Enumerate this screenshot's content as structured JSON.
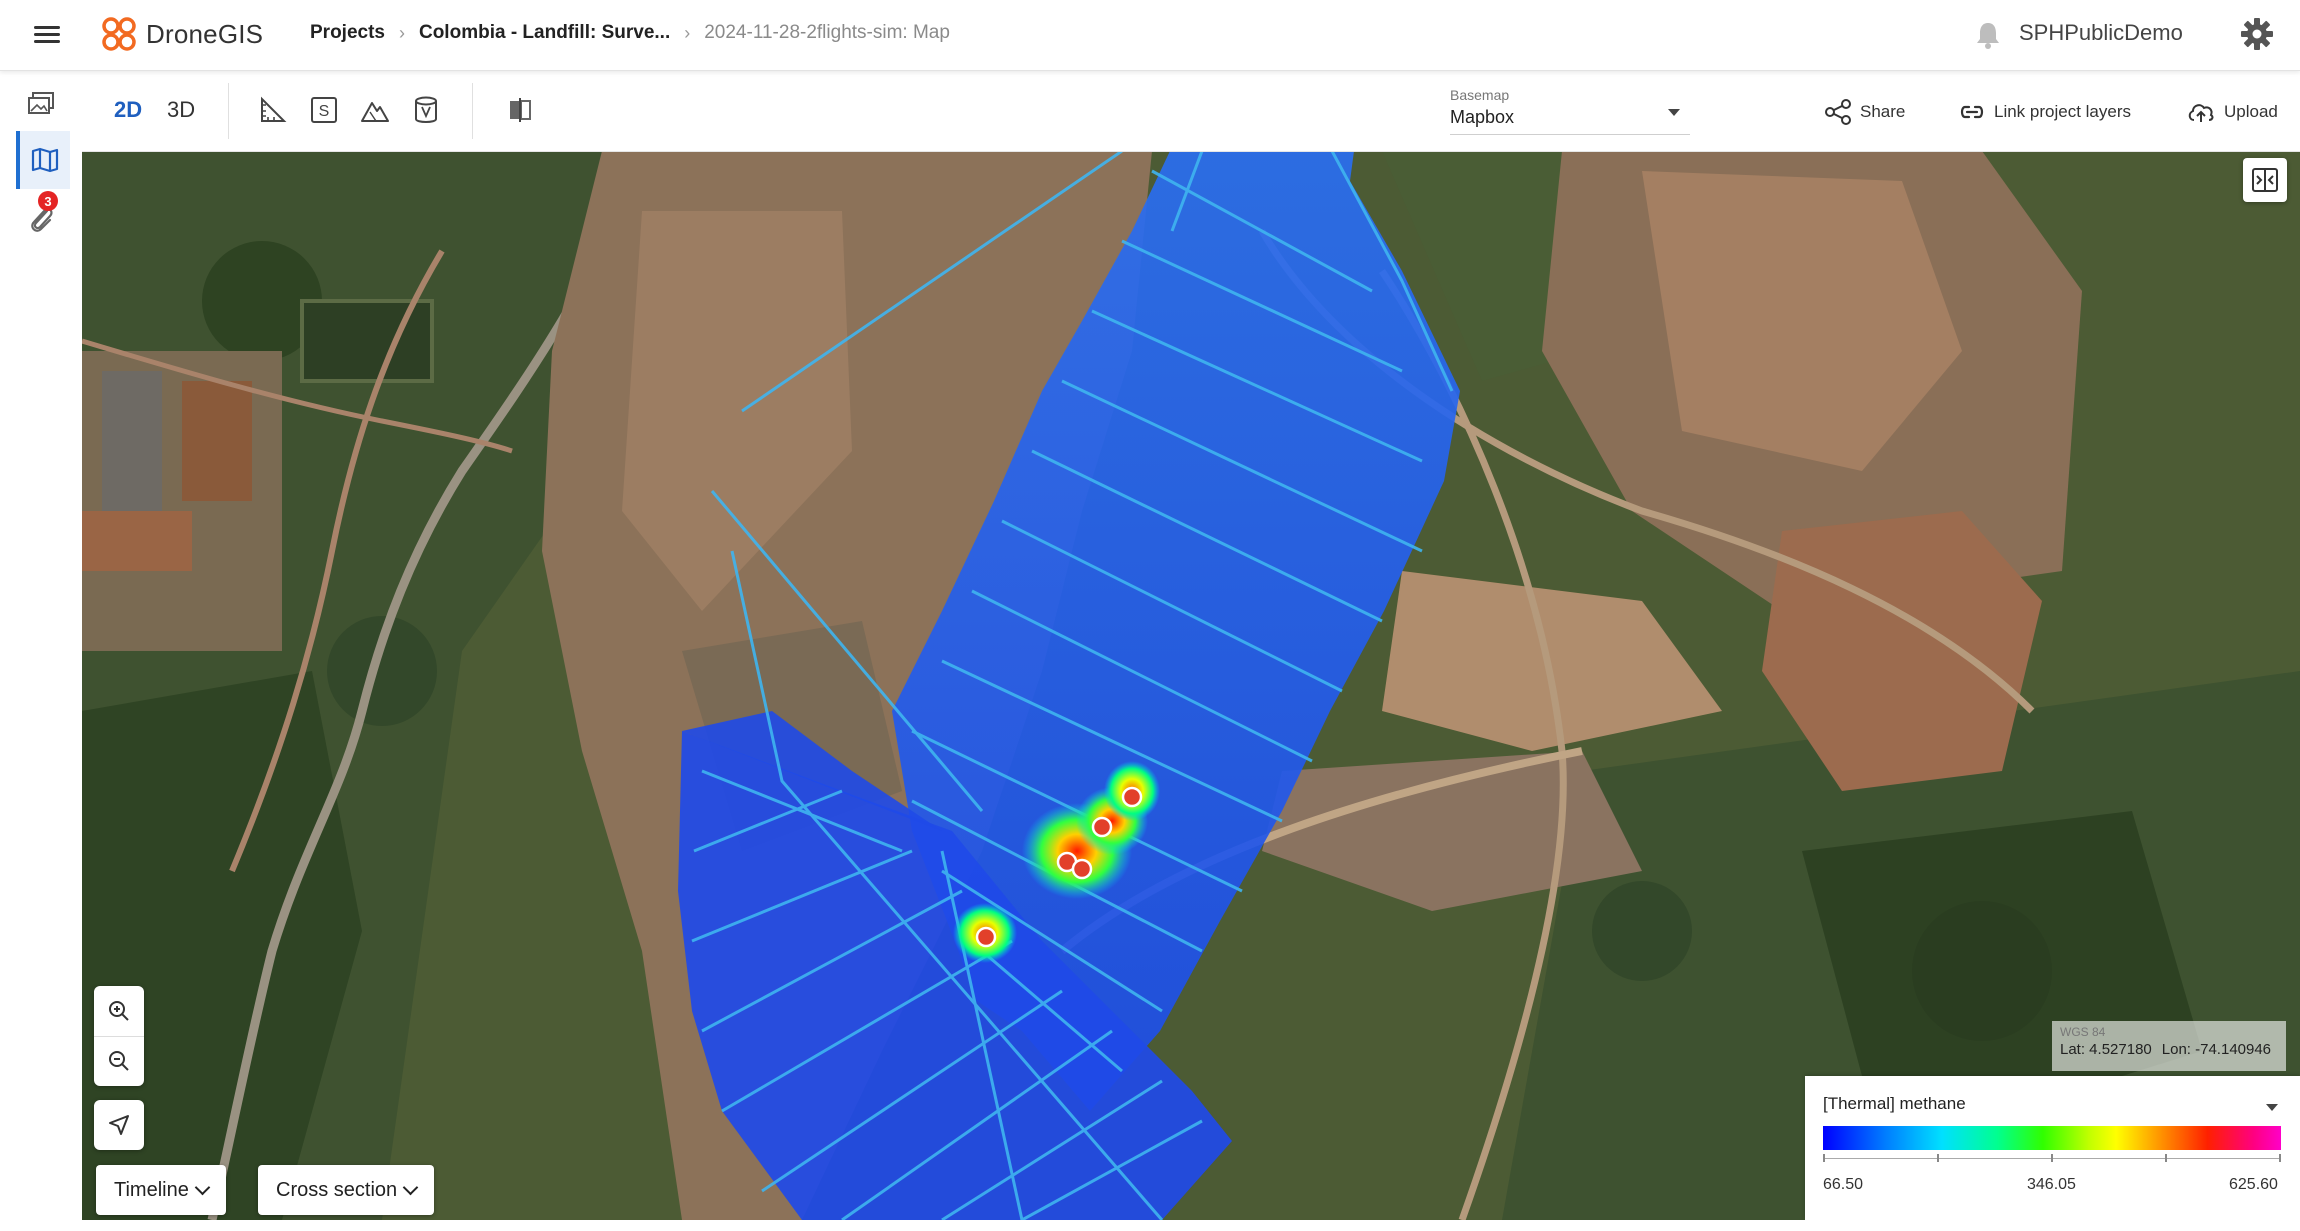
{
  "header": {
    "app_name": "DroneGIS",
    "breadcrumbs": [
      {
        "label": "Projects"
      },
      {
        "label": "Colombia - Landfill: Surve..."
      },
      {
        "label": "2024-11-28-2flights-sim: Map"
      }
    ],
    "username": "SPHPublicDemo"
  },
  "rail": {
    "items": [
      {
        "icon": "layers-icon"
      },
      {
        "icon": "map-icon",
        "active": true
      },
      {
        "icon": "paperclip-icon",
        "badge": "3"
      }
    ]
  },
  "toolbar": {
    "view_2d": "2D",
    "view_3d": "3D",
    "basemap_label": "Basemap",
    "basemap_value": "Mapbox",
    "share_label": "Share",
    "link_layers_label": "Link project layers",
    "upload_label": "Upload"
  },
  "map": {
    "timeline_label": "Timeline",
    "cross_section_label": "Cross section",
    "coords": {
      "crs": "WGS 84",
      "lat": "Lat: 4.527180",
      "lon": "Lon: -74.140946"
    },
    "legend": {
      "layer": "[Thermal] methane",
      "min": "66.50",
      "mid": "346.05",
      "max": "625.60"
    }
  },
  "colors": {
    "accent": "#1f5fbf",
    "flight_line": "#2fa6e8",
    "thermal_low": "#1f49e6",
    "hotspot_marker": "#e2402a"
  }
}
